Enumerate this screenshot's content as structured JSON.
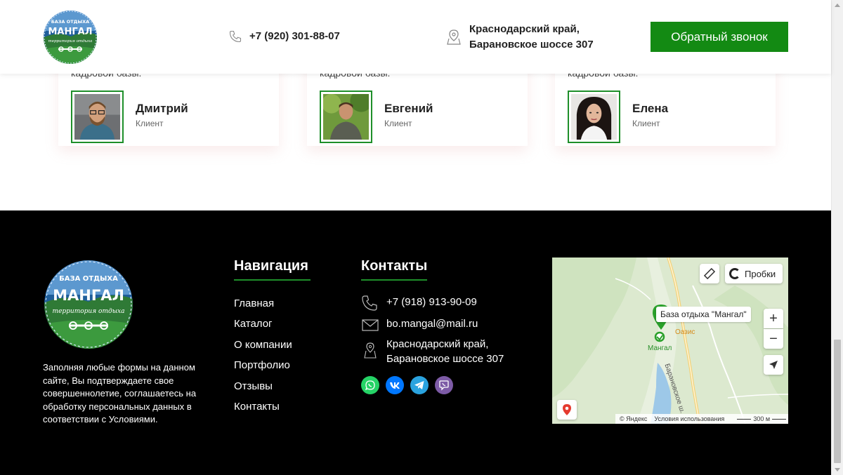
{
  "header": {
    "logo_top": "БАЗА ОТДЫХА",
    "logo_main": "МАНГАЛ",
    "logo_sub": "территория отдыха",
    "phone": "+7 (920) 301-88-07",
    "address_line1": "Краснодарский край,",
    "address_line2": "Барановское шоссе 307",
    "callback_label": "Обратный звонок"
  },
  "testimonials": [
    {
      "quote": "кадровой базы.",
      "name": "Дмитрий",
      "role": "Клиент"
    },
    {
      "quote": "кадровой базы.",
      "name": "Евгений",
      "role": "Клиент"
    },
    {
      "quote": "кадровой базы.",
      "name": "Елена",
      "role": "Клиент"
    }
  ],
  "footer": {
    "consent": "Заполняя любые формы на данном сайте, Вы подтверждаете свое совершеннолетие, соглашаетесь на обработку персональных данных в соответствии с Условиями.",
    "nav_title": "Навигация",
    "nav_items": [
      "Главная",
      "Каталог",
      "О компании",
      "Портфолио",
      "Отзывы",
      "Контакты"
    ],
    "contacts_title": "Контакты",
    "phone": "+7 (918) 913-90-09",
    "email": "bo.mangal@mail.ru",
    "address_line1": "Краснодарский край,",
    "address_line2": "Барановское шоссе 307",
    "socials": [
      {
        "name": "whatsapp",
        "color": "#25d366"
      },
      {
        "name": "vk",
        "color": "#0077ff"
      },
      {
        "name": "telegram",
        "color": "#2aa3df"
      },
      {
        "name": "viber",
        "color": "#7d5ba6"
      }
    ]
  },
  "map": {
    "traffic_label": "Пробки",
    "place_label": "База отдыха \"Мангал\"",
    "oasis_label": "Оазис",
    "mangal_label": "Мангал",
    "road_label": "Барановское ш.",
    "copyright": "© Яндекс",
    "terms": "Условия использования",
    "scale": "300 м"
  },
  "colors": {
    "accent_green": "#138a13",
    "footer_bg": "#000000"
  }
}
